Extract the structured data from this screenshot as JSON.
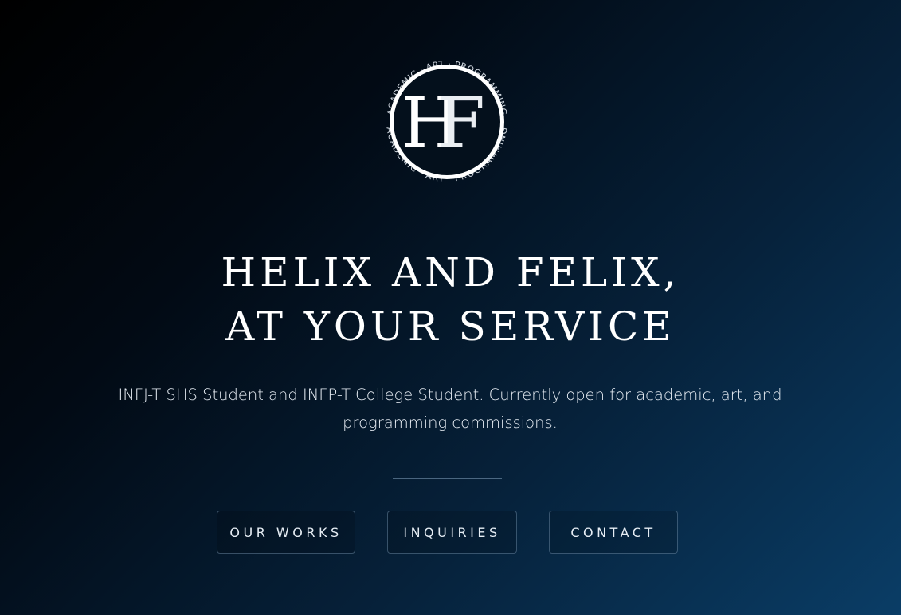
{
  "logo": {
    "monogram_h": "H",
    "monogram_f": "F",
    "ring_text_top": "ACADEMIC · ART · PROGRAMMING",
    "ring_text_bottom": "ACADEMIC · ART · PROGRAMMING"
  },
  "hero": {
    "headline_line1": "HELIX AND FELIX,",
    "headline_line2": "AT YOUR SERVICE",
    "tagline": "INFJ-T SHS Student and INFP-T College Student. Currently open for academic, art, and programming commissions."
  },
  "buttons": {
    "works": "OUR WORKS",
    "inquiries": "INQUIRIES",
    "contact": "CONTACT"
  },
  "colors": {
    "background_start": "#000000",
    "background_end": "#0a3d66",
    "text": "#ffffff"
  }
}
